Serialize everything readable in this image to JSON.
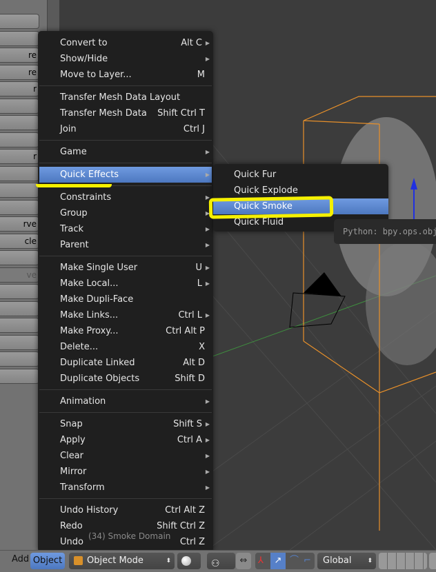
{
  "left_panel": {
    "buttons": [
      "",
      "",
      "re",
      "re",
      "r",
      "",
      "",
      "",
      "r",
      "",
      "",
      "",
      "rve",
      "cle",
      "",
      "ve",
      "",
      "",
      "",
      "",
      "",
      ""
    ]
  },
  "viewport": {
    "scene_label": "(34) Smoke Domain"
  },
  "object_menu": {
    "items": [
      {
        "label": "Convert to",
        "shortcut": "Alt C",
        "submenu": true
      },
      {
        "label": "Show/Hide",
        "shortcut": "",
        "submenu": true
      },
      {
        "label": "Move to Layer...",
        "shortcut": "M",
        "submenu": false
      },
      {
        "sep": true
      },
      {
        "label": "Transfer Mesh Data Layout",
        "shortcut": "",
        "submenu": false
      },
      {
        "label": "Transfer Mesh Data",
        "shortcut": "Shift Ctrl T",
        "submenu": false
      },
      {
        "label": "Join",
        "shortcut": "Ctrl J",
        "submenu": false
      },
      {
        "sep": true
      },
      {
        "label": "Game",
        "shortcut": "",
        "submenu": true
      },
      {
        "sep": true
      },
      {
        "label": "Quick Effects",
        "shortcut": "",
        "submenu": true,
        "highlighted": true
      },
      {
        "sep": true
      },
      {
        "label": "Constraints",
        "shortcut": "",
        "submenu": true
      },
      {
        "label": "Group",
        "shortcut": "",
        "submenu": true
      },
      {
        "label": "Track",
        "shortcut": "",
        "submenu": true
      },
      {
        "label": "Parent",
        "shortcut": "",
        "submenu": true
      },
      {
        "sep": true
      },
      {
        "label": "Make Single User",
        "shortcut": "U",
        "submenu": true
      },
      {
        "label": "Make Local...",
        "shortcut": "L",
        "submenu": true
      },
      {
        "label": "Make Dupli-Face",
        "shortcut": "",
        "submenu": false
      },
      {
        "label": "Make Links...",
        "shortcut": "Ctrl L",
        "submenu": true
      },
      {
        "label": "Make Proxy...",
        "shortcut": "Ctrl Alt P",
        "submenu": false
      },
      {
        "label": "Delete...",
        "shortcut": "X",
        "submenu": false
      },
      {
        "label": "Duplicate Linked",
        "shortcut": "Alt D",
        "submenu": false
      },
      {
        "label": "Duplicate Objects",
        "shortcut": "Shift D",
        "submenu": false
      },
      {
        "sep": true
      },
      {
        "label": "Animation",
        "shortcut": "",
        "submenu": true
      },
      {
        "sep": true
      },
      {
        "label": "Snap",
        "shortcut": "Shift S",
        "submenu": true
      },
      {
        "label": "Apply",
        "shortcut": "Ctrl A",
        "submenu": true
      },
      {
        "label": "Clear",
        "shortcut": "",
        "submenu": true
      },
      {
        "label": "Mirror",
        "shortcut": "",
        "submenu": true
      },
      {
        "label": "Transform",
        "shortcut": "",
        "submenu": true
      },
      {
        "sep": true
      },
      {
        "label": "Undo History",
        "shortcut": "Ctrl Alt Z",
        "submenu": false
      },
      {
        "label": "Redo",
        "shortcut": "Shift Ctrl Z",
        "submenu": false
      },
      {
        "label": "Undo",
        "shortcut": "Ctrl Z",
        "submenu": false
      }
    ]
  },
  "quick_effects_menu": {
    "items": [
      {
        "label": "Quick Fur"
      },
      {
        "label": "Quick Explode"
      },
      {
        "label": "Quick Smoke",
        "highlighted": true
      },
      {
        "label": "Quick Fluid"
      }
    ]
  },
  "tooltip": {
    "text": "Python: bpy.ops.obje"
  },
  "header": {
    "add": "Add",
    "object": "Object",
    "mode": "Object Mode",
    "orientation": "Global"
  },
  "colors": {
    "highlight": "#5680c8",
    "annotation": "#f5f000",
    "grid_box": "#e8902a"
  }
}
